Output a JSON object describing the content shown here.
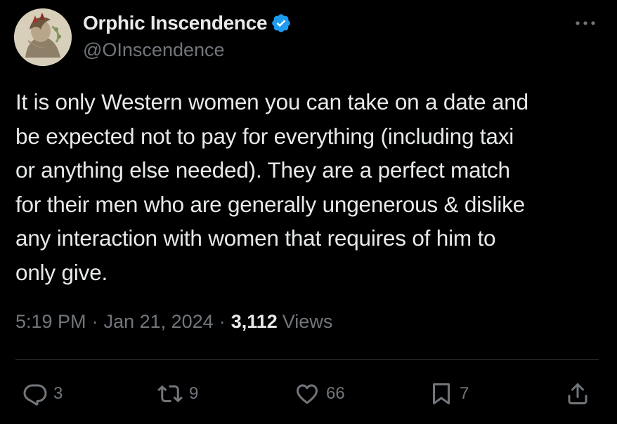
{
  "author": {
    "display_name": "Orphic Inscendence",
    "handle": "@OInscendence",
    "verified": true,
    "verified_color": "#1d9bf0"
  },
  "tweet": {
    "lines": [
      "It is only Western women you can take on a date and",
      "be expected not to pay for everything (including taxi",
      "or anything else needed). They are a perfect match",
      "for their men who are generally ungenerous & dislike",
      "any interaction with women that requires of him to",
      "only give."
    ],
    "time": "5:19 PM",
    "date": "Jan 21, 2024",
    "separator": "·",
    "views_count": "3,112",
    "views_label": "Views"
  },
  "actions": {
    "replies": "3",
    "retweets": "9",
    "likes": "66",
    "bookmarks": "7"
  },
  "icons": {
    "more": "more-horizontal-icon",
    "reply": "reply-icon",
    "retweet": "retweet-icon",
    "like": "heart-icon",
    "bookmark": "bookmark-icon",
    "share": "share-icon"
  }
}
